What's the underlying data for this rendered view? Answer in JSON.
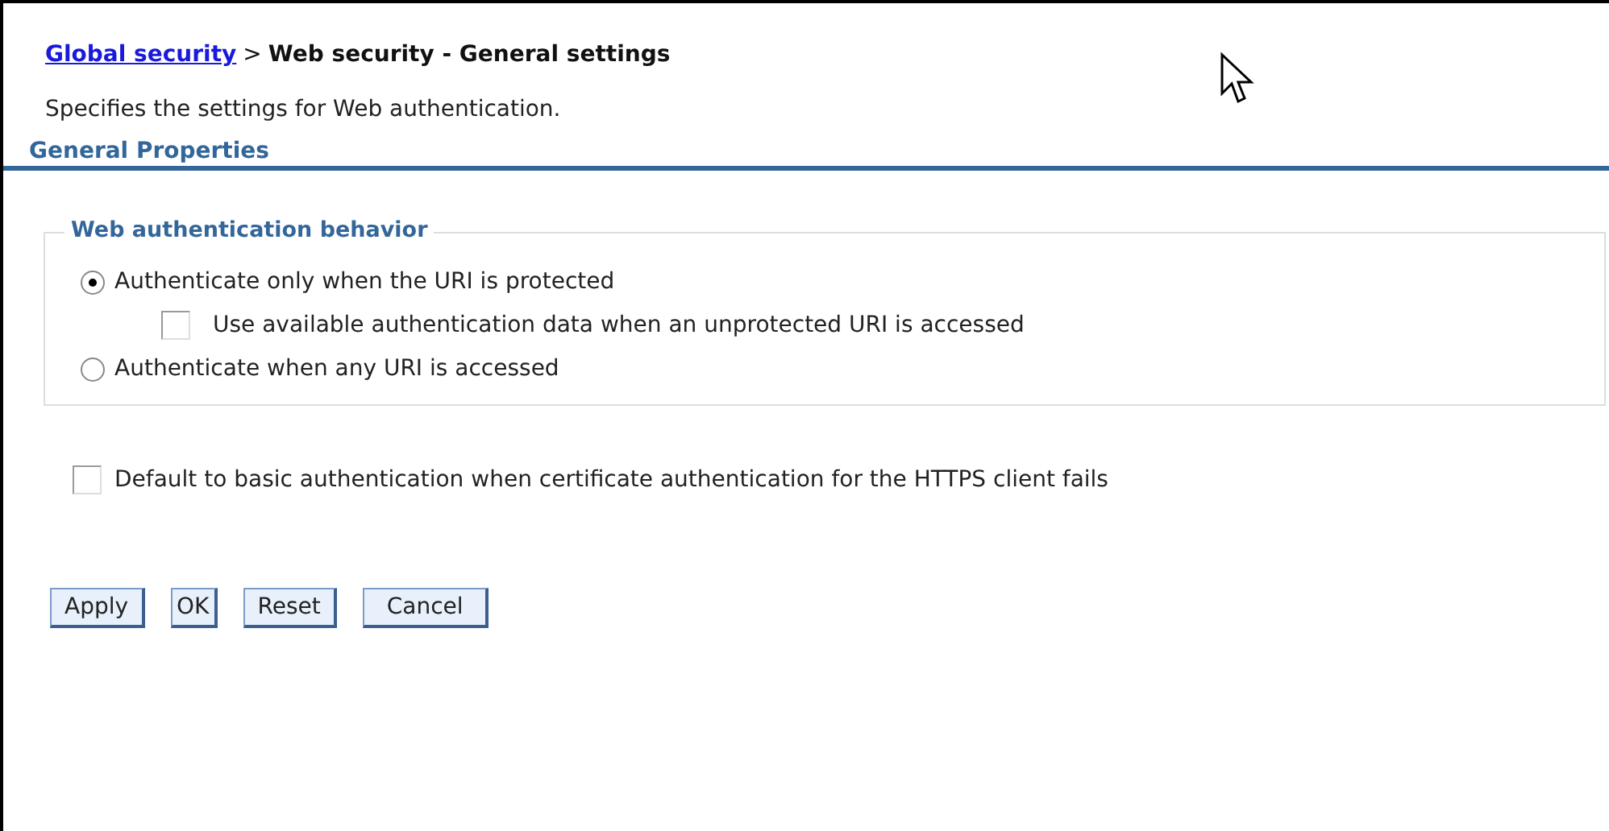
{
  "breadcrumb": {
    "link": "Global security",
    "separator": ">",
    "current": "Web security - General settings"
  },
  "description": "Specifies the settings for Web authentication.",
  "section_title": "General Properties",
  "fieldset": {
    "legend": "Web authentication behavior",
    "options": [
      {
        "kind": "radio",
        "label": "Authenticate only when the URI is protected",
        "selected": true,
        "children": [
          {
            "kind": "checkbox",
            "label": "Use available authentication data when an unprotected URI is accessed",
            "checked": false
          }
        ]
      },
      {
        "kind": "radio",
        "label": "Authenticate when any URI is accessed",
        "selected": false
      }
    ]
  },
  "default_basic": {
    "label": "Default to basic authentication when certificate authentication for the HTTPS client fails",
    "checked": false
  },
  "buttons": [
    "Apply",
    "OK",
    "Reset",
    "Cancel"
  ]
}
